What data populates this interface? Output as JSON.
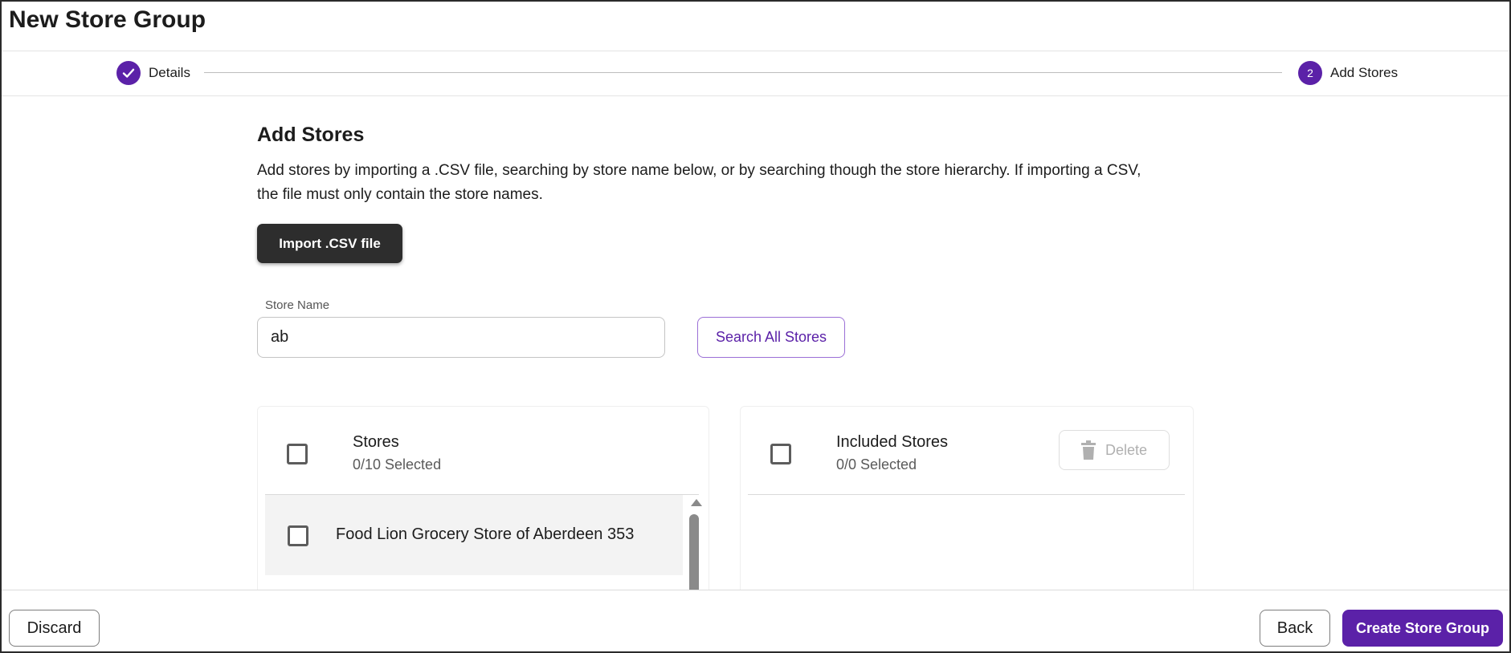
{
  "page": {
    "title": "New Store Group"
  },
  "stepper": {
    "steps": [
      {
        "label": "Details",
        "state": "completed",
        "icon": "check-icon"
      },
      {
        "label": "Add Stores",
        "number": "2",
        "state": "active"
      }
    ],
    "accent_color": "#5b21a8"
  },
  "section": {
    "title": "Add Stores",
    "description": "Add stores by importing a .CSV file, searching by store name below, or by searching though the store hierarchy. If importing a CSV, the file must only contain the store names.",
    "import_button": "Import .CSV file"
  },
  "search": {
    "label": "Store Name",
    "value": "ab",
    "button": "Search All Stores"
  },
  "stores_panel": {
    "title": "Stores",
    "selected": "0/10 Selected",
    "items": [
      {
        "label": "Food Lion Grocery Store of Aberdeen 353",
        "checked": false
      }
    ]
  },
  "included_panel": {
    "title": "Included Stores",
    "selected": "0/0 Selected",
    "delete_button": "Delete",
    "delete_icon": "trash-icon"
  },
  "footer": {
    "discard": "Discard",
    "back": "Back",
    "create": "Create Store Group"
  }
}
